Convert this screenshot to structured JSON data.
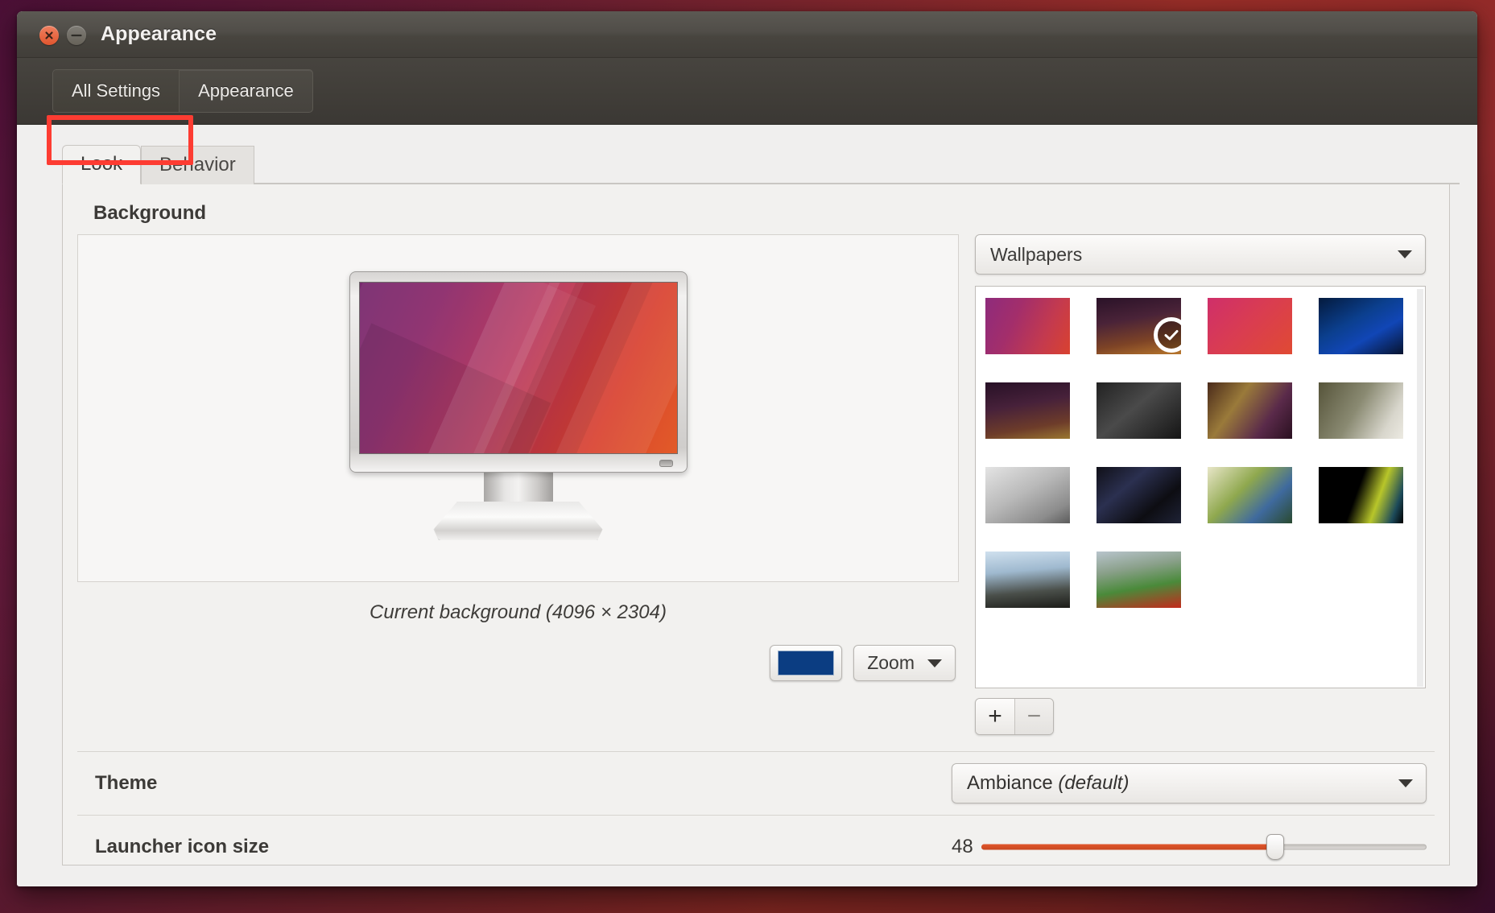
{
  "window": {
    "title": "Appearance",
    "close_icon": "close-icon",
    "minimize_icon": "minimize-icon"
  },
  "toolbar": {
    "crumbs": [
      {
        "label": "All Settings",
        "active": true
      },
      {
        "label": "Appearance",
        "active": false
      }
    ]
  },
  "tabs": [
    {
      "label": "Look",
      "active": true
    },
    {
      "label": "Behavior",
      "active": false
    }
  ],
  "background_section": {
    "title": "Background",
    "preview_caption": "Current background (4096 × 2304)",
    "color_swatch": "#0b3d82",
    "scaling_mode": "Zoom",
    "caret_icon": "chevron-down-icon"
  },
  "wallpapers": {
    "source_label": "Wallpapers",
    "caret_icon": "chevron-down-icon",
    "add_label": "+",
    "remove_label": "−",
    "selected_index": 1,
    "check_icon": "check-icon",
    "thumbs": [
      {
        "name": "ubuntu-suru-gradient",
        "css": "linear-gradient(115deg,#8e2b7c 0%,#a32e6b 35%,#c43a4e 70%,#d9422f 100%)"
      },
      {
        "name": "milky-way-hills",
        "css": "linear-gradient(170deg,#2a1228 0%,#4a2338 38%,#7d4326 72%,#b8772c 100%)"
      },
      {
        "name": "ubuntu-spiral-red",
        "css": "linear-gradient(135deg,#cf2f6a 0%,#d93c52 45%,#e04a33 100%)"
      },
      {
        "name": "blue-eclipse",
        "css": "linear-gradient(150deg,#041a3d 0%,#0b3f8e 40%,#1146b6 65%,#07132e 100%)"
      },
      {
        "name": "night-sky-ridge",
        "css": "linear-gradient(170deg,#271026 0%,#47213a 40%,#6d3c2a 75%,#9a7730 100%)"
      },
      {
        "name": "street-clock-mono",
        "css": "linear-gradient(140deg,#222222 0%,#4a4a4a 45%,#151515 100%)"
      },
      {
        "name": "blurred-lights-bokeh",
        "css": "linear-gradient(125deg,#4a2a1a 0%,#9a7a3a 35%,#5a2a4a 70%,#2a1020 100%)"
      },
      {
        "name": "frosted-grass",
        "css": "linear-gradient(120deg,#56543a 0%,#8a8a72 45%,#d8d6cc 80%,#eceae2 100%)"
      },
      {
        "name": "ice-bubbles",
        "css": "linear-gradient(150deg,#e4e4e4 0%,#b9b9b9 45%,#8c8c8c 80%,#5c5c5c 100%)"
      },
      {
        "name": "night-city-sparkle",
        "css": "linear-gradient(140deg,#101018 0%,#2b3050 35%,#0d0d12 70%,#1e2236 100%)"
      },
      {
        "name": "dragonfly-flower",
        "css": "linear-gradient(135deg,#e8e6c8 0%,#8fa84e 40%,#3f6a9e 70%,#2a4a30 100%)"
      },
      {
        "name": "yellow-bloom-dark",
        "css": "linear-gradient(110deg,#000000 0%,#000000 45%,#b8c62a 68%,#1c4a5a 88%,#000000 100%)"
      },
      {
        "name": "misty-forest",
        "css": "linear-gradient(175deg,#cfe0ee 0%,#9fb9cf 35%,#4a4f4a 70%,#1c1c18 100%)"
      },
      {
        "name": "poppy-field",
        "css": "linear-gradient(170deg,#b8c4cc 0%,#8aa08a 32%,#4a8a3a 62%,#c42a1c 100%)"
      }
    ]
  },
  "theme": {
    "label": "Theme",
    "value": "Ambiance",
    "value_suffix": "(default)",
    "caret_icon": "chevron-down-icon"
  },
  "launcher": {
    "label": "Launcher icon size",
    "value": "48",
    "fill_percent": 66
  },
  "colors": {
    "accent_orange": "#e0562c",
    "titlebar": "#484540",
    "panel_bg": "#f2f1ef",
    "highlight_box": "#fd3c32"
  }
}
